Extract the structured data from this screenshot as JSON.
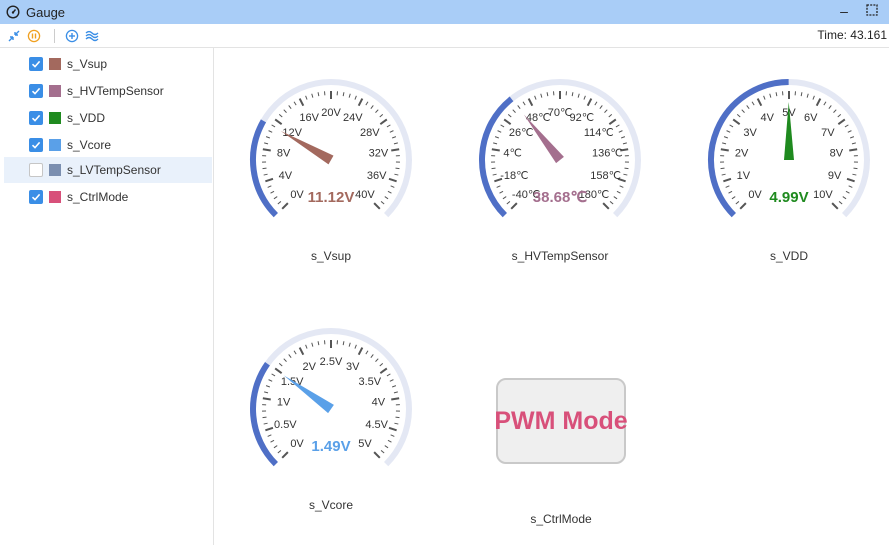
{
  "window": {
    "title": "Gauge",
    "icons": {
      "app": "gauge-icon",
      "minimize": "minimize-icon",
      "maximize": "maximize-icon"
    }
  },
  "toolbar": {
    "icons": [
      "collapse-icon",
      "pause-icon",
      "add-icon",
      "signal-icon"
    ],
    "time_label": "Time: 43.161"
  },
  "signals": [
    {
      "name": "s_Vsup",
      "checked": true,
      "color": "#a3695e",
      "selected": false
    },
    {
      "name": "s_HVTempSensor",
      "checked": true,
      "color": "#a46f8e",
      "selected": false
    },
    {
      "name": "s_VDD",
      "checked": true,
      "color": "#1f8a1f",
      "selected": false
    },
    {
      "name": "s_Vcore",
      "checked": true,
      "color": "#5aa0e8",
      "selected": false
    },
    {
      "name": "s_LVTempSensor",
      "checked": false,
      "color": "#7b8fb0",
      "selected": true
    },
    {
      "name": "s_CtrlMode",
      "checked": true,
      "color": "#d8507a",
      "selected": false
    }
  ],
  "gauges": [
    {
      "name": "s_Vsup",
      "min": 0,
      "max": 40,
      "value": 11.12,
      "value_text": "11.12V",
      "color": "#a3695e",
      "labels": [
        "0V",
        "4V",
        "8V",
        "12V",
        "16V",
        "20V",
        "24V",
        "28V",
        "32V",
        "36V",
        "40V"
      ]
    },
    {
      "name": "s_HVTempSensor",
      "min": -40,
      "max": 180,
      "value": 38.68,
      "value_text": "38.68℃",
      "color": "#a46f8e",
      "labels": [
        "-40℃",
        "-18℃",
        "4℃",
        "26℃",
        "48℃",
        "70℃",
        "92℃",
        "114℃",
        "136℃",
        "158℃",
        "180℃"
      ]
    },
    {
      "name": "s_VDD",
      "min": 0,
      "max": 10,
      "value": 4.99,
      "value_text": "4.99V",
      "color": "#1f8a1f",
      "labels": [
        "0V",
        "1V",
        "2V",
        "3V",
        "4V",
        "5V",
        "6V",
        "7V",
        "8V",
        "9V",
        "10V"
      ]
    },
    {
      "name": "s_Vcore",
      "min": 0,
      "max": 5,
      "value": 1.49,
      "value_text": "1.49V",
      "color": "#5aa0e8",
      "labels": [
        "0V",
        "0.5V",
        "1V",
        "1.5V",
        "2V",
        "2.5V",
        "3V",
        "3.5V",
        "4V",
        "4.5V",
        "5V"
      ]
    }
  ],
  "ctrl_mode": {
    "name": "s_CtrlMode",
    "text": "PWM Mode",
    "color": "#d8507a"
  },
  "colors": {
    "progress": "#4f6fc6",
    "track": "#e4e8f4",
    "ticks": "#555555"
  }
}
